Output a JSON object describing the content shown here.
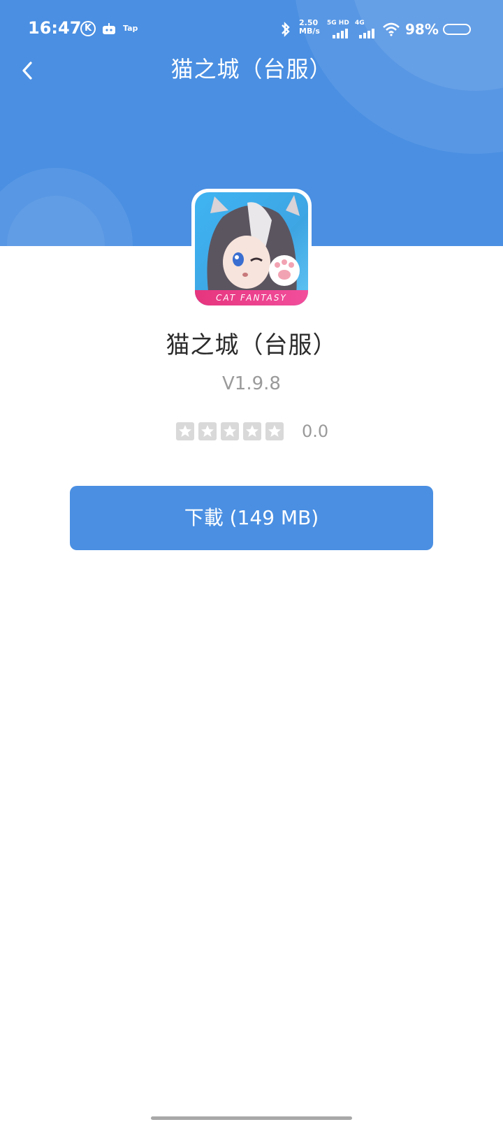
{
  "status_bar": {
    "time": "16:47",
    "k_badge": "K",
    "tap_label": "Tap",
    "speed_value": "2.50",
    "speed_unit": "MB/s",
    "network1": "5G HD",
    "network2": "4G",
    "battery_percent": "98%"
  },
  "nav": {
    "title": "猫之城（台服）"
  },
  "app": {
    "icon_caption": "CAT FANTASY",
    "name": "猫之城（台服）",
    "version": "V1.9.8",
    "rating": "0.0",
    "star_count_filled": 0,
    "star_total": 5
  },
  "download_button": {
    "label": "下載 (149 MB)"
  },
  "colors": {
    "primary": "#4a8fe2",
    "star_empty": "#d9d9d9",
    "text_secondary": "#9a9a9a"
  }
}
